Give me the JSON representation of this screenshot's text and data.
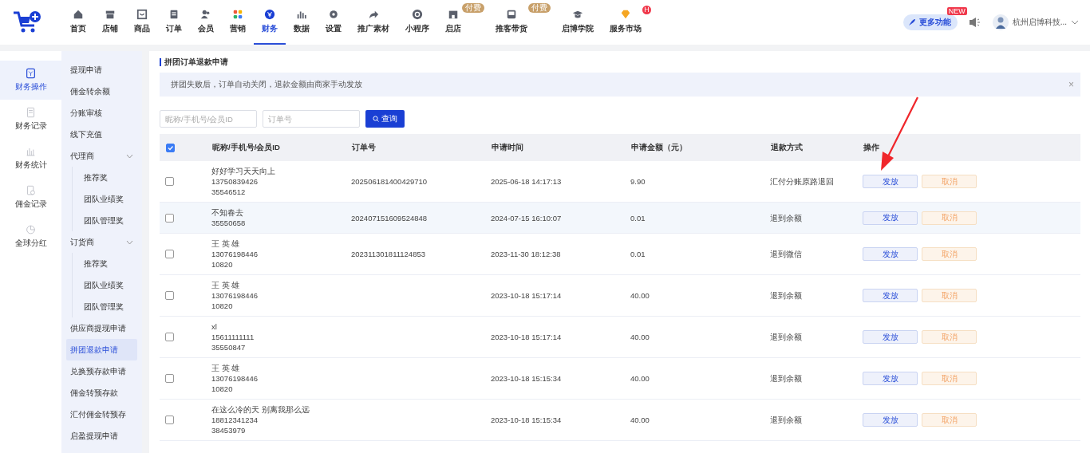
{
  "nav": {
    "items": [
      {
        "label": "首页",
        "selected": false
      },
      {
        "label": "店铺",
        "selected": false
      },
      {
        "label": "商品",
        "selected": false
      },
      {
        "label": "订单",
        "selected": false
      },
      {
        "label": "会员",
        "selected": false
      },
      {
        "label": "营销",
        "selected": false
      },
      {
        "label": "财务",
        "selected": true
      },
      {
        "label": "数据",
        "selected": false
      },
      {
        "label": "设置",
        "selected": false
      },
      {
        "label": "推广素材",
        "selected": false
      },
      {
        "label": "小程序",
        "selected": false
      },
      {
        "label": "启店",
        "selected": false,
        "badge": "付费"
      },
      {
        "label": "推客带货",
        "selected": false,
        "badge": "付费"
      },
      {
        "label": "启博学院",
        "selected": false
      },
      {
        "label": "服务市场",
        "selected": false,
        "dot": "H"
      }
    ],
    "more": {
      "label": "更多功能",
      "badge": "NEW"
    },
    "account": "杭州启博科技..."
  },
  "rail": [
    {
      "label": "财务操作",
      "selected": true
    },
    {
      "label": "财务记录",
      "selected": false
    },
    {
      "label": "财务统计",
      "selected": false
    },
    {
      "label": "佣金记录",
      "selected": false
    },
    {
      "label": "全球分红",
      "selected": false
    }
  ],
  "submenu": [
    {
      "label": "提现申请",
      "selected": false
    },
    {
      "label": "佣金转余额",
      "selected": false
    },
    {
      "label": "分账审核",
      "selected": false
    },
    {
      "label": "线下充值",
      "selected": false
    },
    {
      "label": "代理商",
      "selected": false,
      "expanded": true,
      "children": [
        {
          "label": "推荐奖",
          "selected": false
        },
        {
          "label": "团队业绩奖",
          "selected": false
        },
        {
          "label": "团队管理奖",
          "selected": false
        }
      ]
    },
    {
      "label": "订货商",
      "selected": false,
      "expanded": true,
      "children": [
        {
          "label": "推荐奖",
          "selected": false
        },
        {
          "label": "团队业绩奖",
          "selected": false
        },
        {
          "label": "团队管理奖",
          "selected": false
        }
      ]
    },
    {
      "label": "供应商提现申请",
      "selected": false
    },
    {
      "label": "拼团退款申请",
      "selected": true
    },
    {
      "label": "兑换预存款申请",
      "selected": false
    },
    {
      "label": "佣金转预存款",
      "selected": false
    },
    {
      "label": "汇付佣金转预存",
      "selected": false
    },
    {
      "label": "启盈提现申请",
      "selected": false
    }
  ],
  "page": {
    "title": "拼团订单退款申请",
    "notice": "拼团失败后，订单自动关闭，退款金额由商家手动发放",
    "notice_close": "×",
    "filters": [
      {
        "placeholder": "昵称/手机号/会员ID"
      },
      {
        "placeholder": "订单号"
      }
    ],
    "search_button": "查询"
  },
  "table": {
    "select_all": true,
    "columns": [
      "昵称/手机号/会员ID",
      "订单号",
      "申请时间",
      "申请金额（元）",
      "退款方式",
      "操作"
    ],
    "rows": [
      {
        "checked": false,
        "hovered": false,
        "member": [
          "好好学习天天向上",
          "13750839426",
          "35546512"
        ],
        "order": "202506181400429710",
        "time": "2025-06-18 14:17:13",
        "amount": "9.90",
        "method": "汇付分账原路退回",
        "actions": [
          "发放",
          "取消"
        ]
      },
      {
        "checked": false,
        "hovered": true,
        "member": [
          "不知春去",
          "35550658"
        ],
        "order": "202407151609524848",
        "time": "2024-07-15 16:10:07",
        "amount": "0.01",
        "method": "退到余额",
        "actions": [
          "发放",
          "取消"
        ]
      },
      {
        "checked": false,
        "hovered": false,
        "member": [
          "王 英 雄",
          "13076198446",
          "10820"
        ],
        "order": "202311301811124853",
        "time": "2023-11-30 18:12:38",
        "amount": "0.01",
        "method": "退到微信",
        "actions": [
          "发放",
          "取消"
        ]
      },
      {
        "checked": false,
        "hovered": false,
        "member": [
          "王 英 雄",
          "13076198446",
          "10820"
        ],
        "time": "2023-10-18 15:17:14",
        "amount": "40.00",
        "method": "退到余额",
        "actions": [
          "发放",
          "取消"
        ]
      },
      {
        "checked": false,
        "hovered": false,
        "member": [
          "xl",
          "15611111111",
          "35550847"
        ],
        "time": "2023-10-18 15:17:14",
        "amount": "40.00",
        "method": "退到余额",
        "actions": [
          "发放",
          "取消"
        ]
      },
      {
        "checked": false,
        "hovered": false,
        "member": [
          "王 英 雄",
          "13076198446",
          "10820"
        ],
        "time": "2023-10-18 15:15:34",
        "amount": "40.00",
        "method": "退到余额",
        "actions": [
          "发放",
          "取消"
        ]
      },
      {
        "checked": false,
        "hovered": false,
        "member": [
          "在这么冷的天 别离我那么远",
          "18812341234",
          "38453979"
        ],
        "time": "2023-10-18 15:15:34",
        "amount": "40.00",
        "method": "退到余额",
        "actions": [
          "发放",
          "取消"
        ]
      }
    ]
  }
}
